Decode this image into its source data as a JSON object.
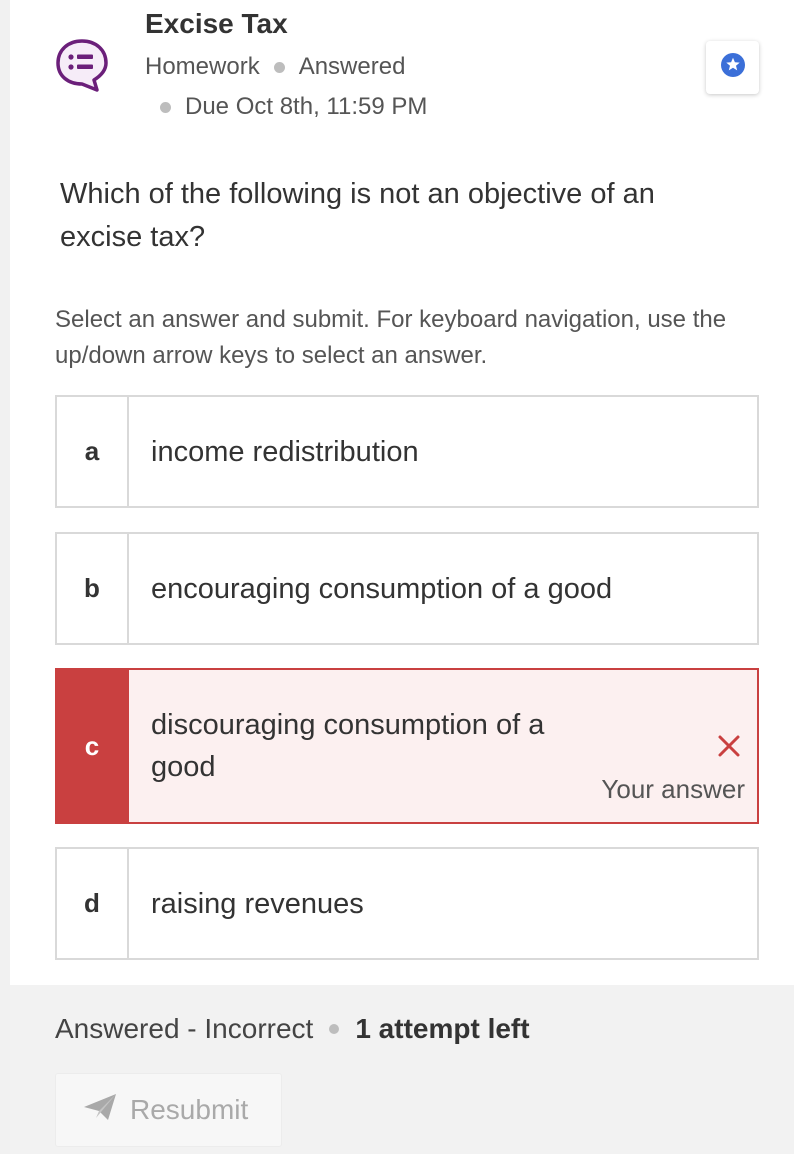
{
  "header": {
    "title": "Excise Tax",
    "type": "Homework",
    "status": "Answered",
    "due": "Due Oct 8th, 11:59 PM",
    "icon": "homework-chat-icon",
    "star_icon": "star-icon"
  },
  "question": {
    "prompt": "Which of the following is not an objective of an excise tax?",
    "instructions": "Select an answer and submit. For keyboard navigation, use the up/down arrow keys to select an answer."
  },
  "options": [
    {
      "letter": "a",
      "text": "income redistribution"
    },
    {
      "letter": "b",
      "text": "encouraging consumption of a good"
    },
    {
      "letter": "c",
      "text": "discouraging consumption of a good",
      "selected": true,
      "correct": false,
      "feedback": "Your answer"
    },
    {
      "letter": "d",
      "text": "raising revenues"
    }
  ],
  "footer": {
    "result": "Answered - Incorrect",
    "attempts": "1 attempt left",
    "resubmit_label": "Resubmit"
  },
  "colors": {
    "accent_purple": "#6b1f7a",
    "star_blue": "#3b6fd8",
    "incorrect_red": "#c94040",
    "incorrect_bg": "#fcf0f0"
  }
}
